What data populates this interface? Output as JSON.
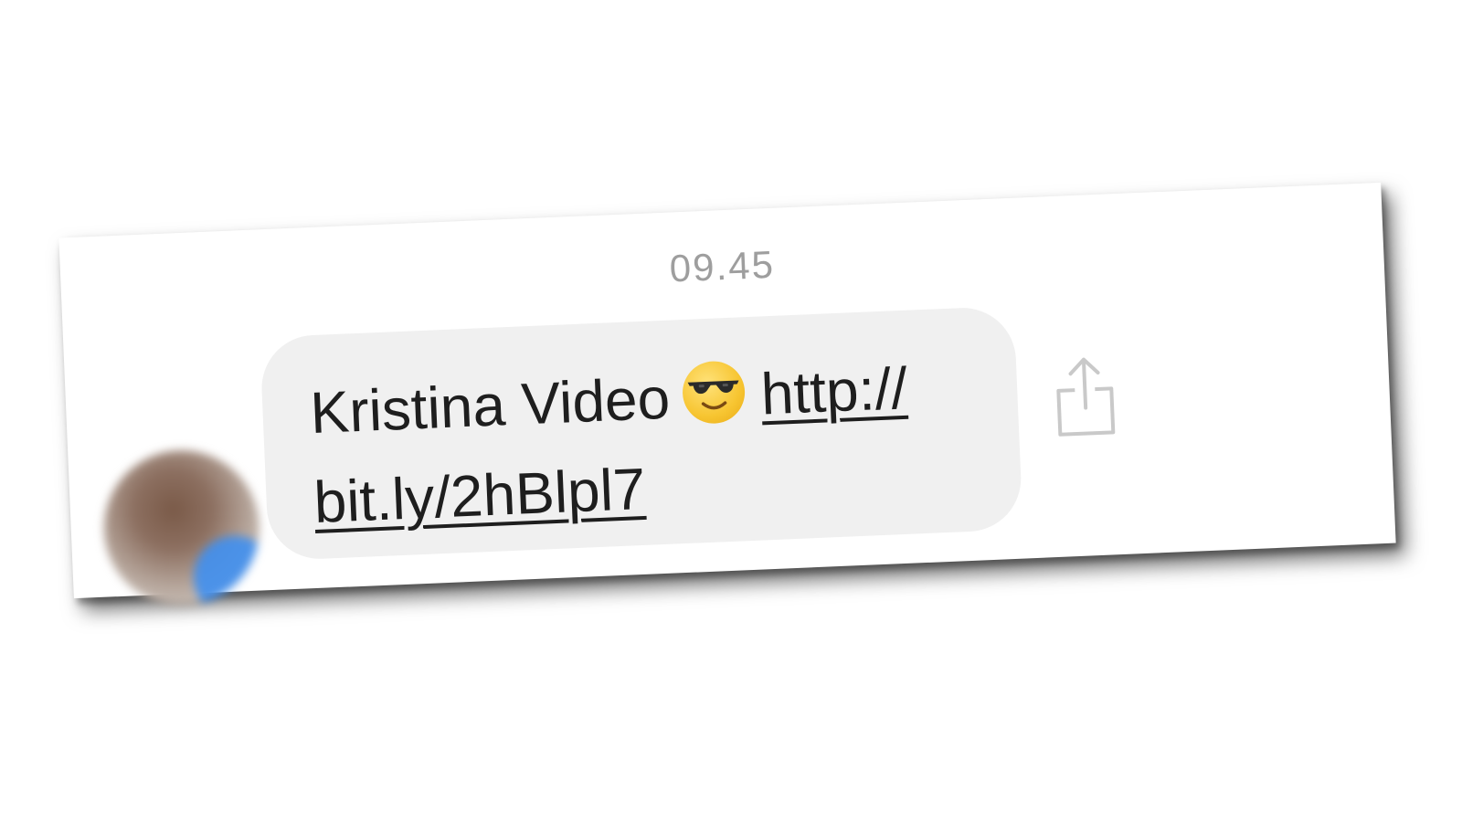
{
  "chat": {
    "timestamp": "09.45",
    "message": {
      "text": "Kristina Video",
      "emoji": "smiling-face-with-sunglasses",
      "link_part1": "http://",
      "link_part2": "bit.ly/2hBlpl7"
    },
    "colors": {
      "bubble": "#f0f0f0",
      "text": "#1e1e1e",
      "timestamp": "#9e9e9e",
      "avatar_badge": "#3f8ff0"
    },
    "icons": [
      "share-icon"
    ]
  }
}
